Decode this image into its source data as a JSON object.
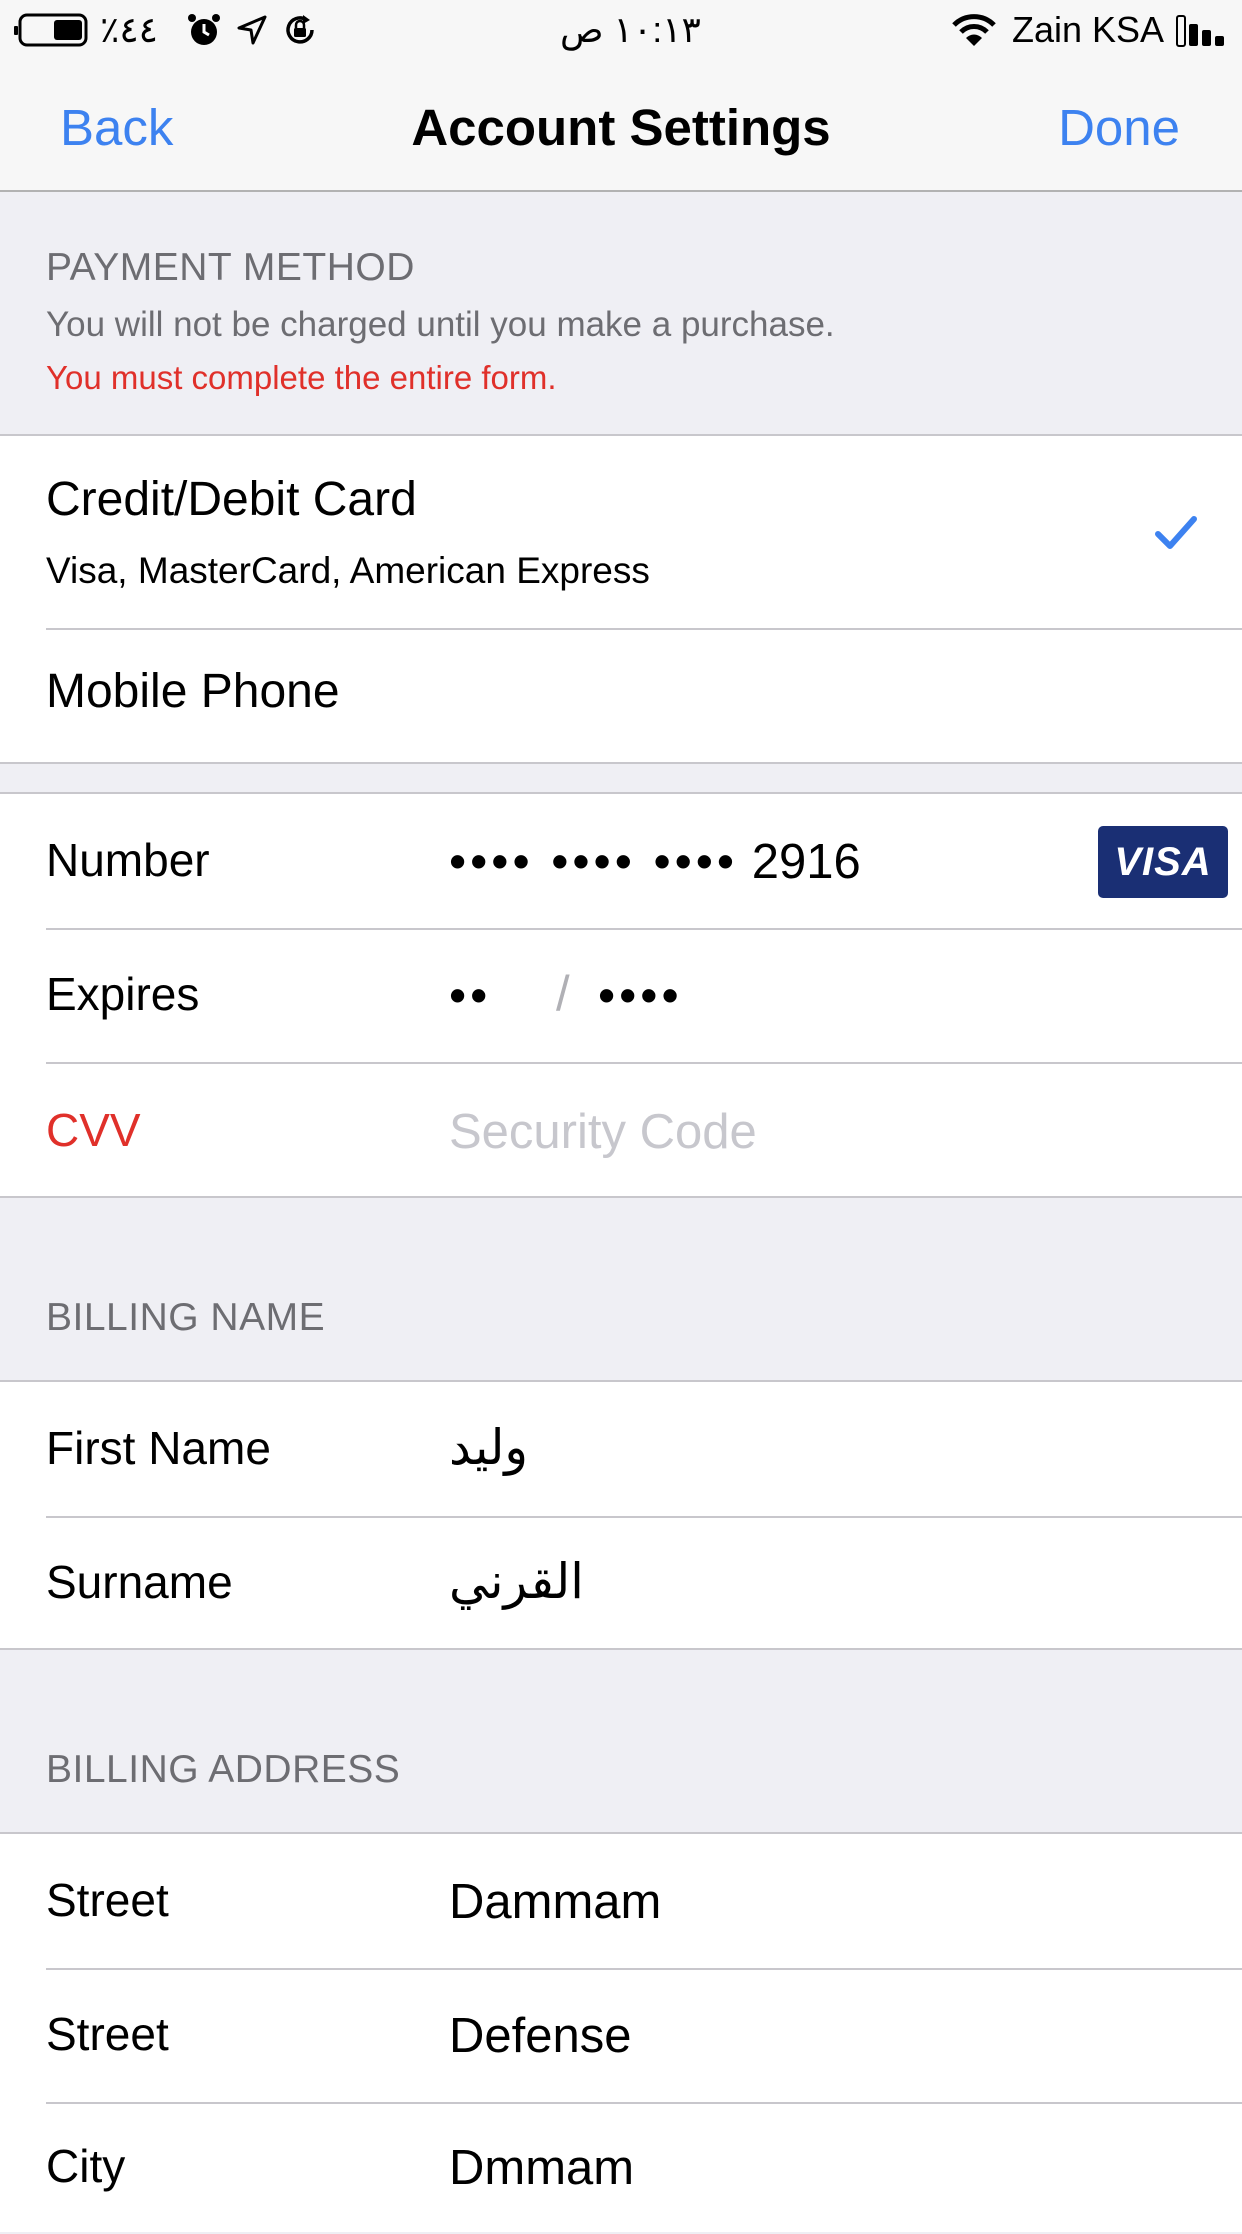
{
  "status_bar": {
    "battery": "٪٤٤",
    "time": "١٠:١٣ ص",
    "carrier": "Zain KSA"
  },
  "nav": {
    "back_label": "Back",
    "title": "Account Settings",
    "done_label": "Done"
  },
  "payment": {
    "header": "PAYMENT METHOD",
    "subtitle": "You will not be charged until you make a purchase.",
    "error": "You must complete the entire form.",
    "options": [
      {
        "title": "Credit/Debit Card",
        "subtitle": "Visa, MasterCard, American Express",
        "selected": true
      },
      {
        "title": "Mobile Phone",
        "selected": false
      }
    ]
  },
  "card": {
    "number_label": "Number",
    "number_dots": "•••• •••• ••••",
    "number_last4": "2916",
    "card_brand": "VISA",
    "expires_label": "Expires",
    "expires_month": "••",
    "expires_slash": "/",
    "expires_year": "••••",
    "cvv_label": "CVV",
    "cvv_placeholder": "Security Code"
  },
  "billing_name": {
    "header": "BILLING NAME",
    "first_name_label": "First Name",
    "first_name_value": "وليد",
    "surname_label": "Surname",
    "surname_value": "القرني"
  },
  "billing_address": {
    "header": "BILLING ADDRESS",
    "rows": [
      {
        "label": "Street",
        "value": "Dammam"
      },
      {
        "label": "Street",
        "value": "Defense"
      },
      {
        "label": "City",
        "value": "Dmmam"
      }
    ]
  },
  "colors": {
    "accent": "#3d82f0",
    "error": "#e0302a",
    "visa_blue": "#1a2f74"
  }
}
